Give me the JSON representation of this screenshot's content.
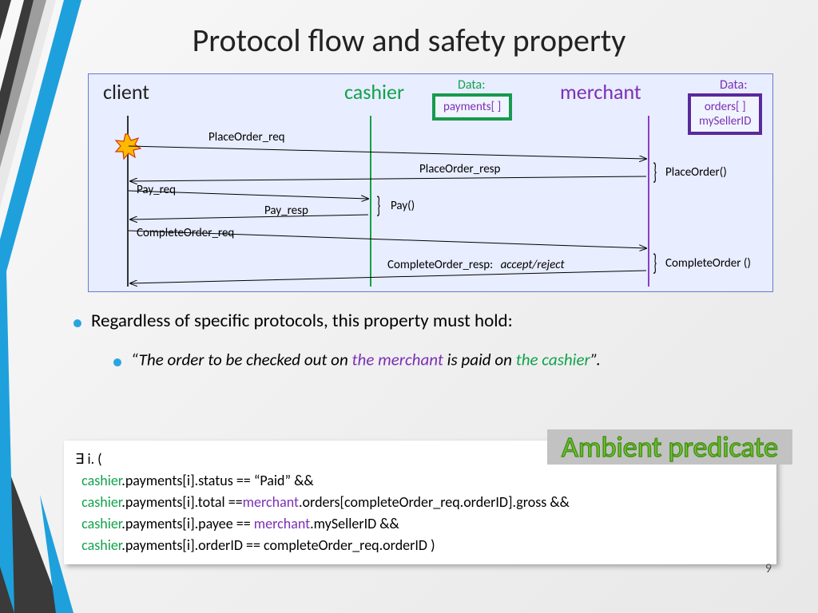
{
  "title": "Protocol flow and safety property",
  "actors": {
    "client": "client",
    "cashier": "cashier",
    "merchant": "merchant"
  },
  "data_label": "Data:",
  "cashier_data": "payments[ ]",
  "merchant_data_1": "orders[ ]",
  "merchant_data_2": "mySellerID",
  "messages": {
    "place_req": "PlaceOrder_req",
    "place_resp": "PlaceOrder_resp",
    "pay_req": "Pay_req",
    "pay_resp": "Pay_resp",
    "complete_req": "CompleteOrder_req",
    "complete_resp_prefix": "CompleteOrder_resp:",
    "complete_resp_suffix": "accept/reject"
  },
  "methods": {
    "place": "PlaceOrder()",
    "pay": "Pay()",
    "complete": "CompleteOrder ()"
  },
  "bullet_main": "Regardless of specific protocols, this property must hold:",
  "bullet_sub_open": "“",
  "bullet_sub_1": "The order to be checked out on ",
  "bullet_sub_merchant": "the merchant",
  "bullet_sub_2": " is paid on ",
  "bullet_sub_cashier": "the cashier",
  "bullet_sub_close": "”.",
  "ambient": "Ambient predicate",
  "pred": {
    "l1": "∃ i. (",
    "l2a": "cashier",
    "l2b": ".payments[i].status == “Paid”  &&",
    "l3a": "cashier",
    "l3b": ".payments[i].total ==",
    "l3c": "merchant",
    "l3d": ".orders[completeOrder_req.orderID].gross &&",
    "l4a": "cashier",
    "l4b": ".payments[i].payee == ",
    "l4c": "merchant",
    "l4d": ".mySellerID &&",
    "l5a": "cashier",
    "l5b": ".payments[i].orderID == completeOrder_req.orderID  )"
  },
  "slide_number": "9"
}
